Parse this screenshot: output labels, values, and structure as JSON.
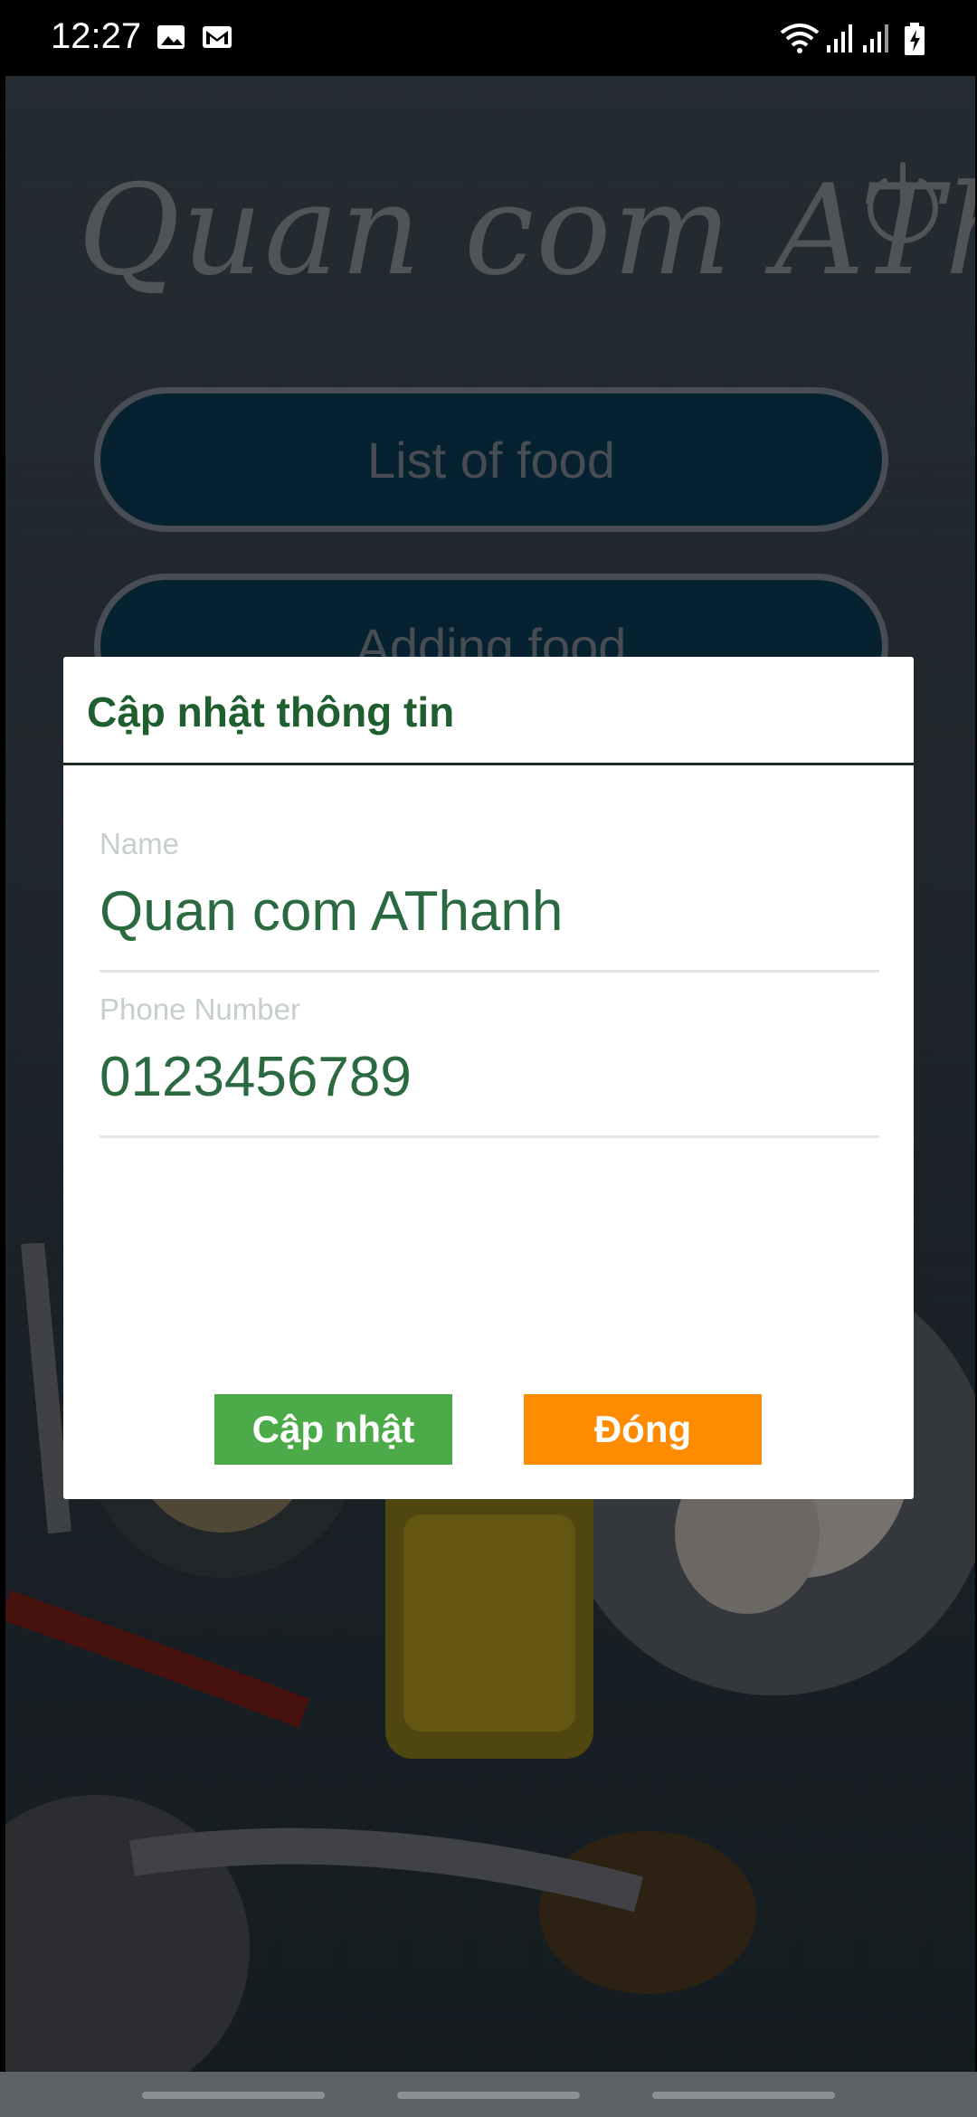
{
  "status_bar": {
    "time": "12:27",
    "icons": [
      "image-icon",
      "gmail-icon",
      "wifi-icon",
      "signal-icon",
      "signal-icon",
      "battery-charging-icon"
    ]
  },
  "app": {
    "title": "Quan com AThanh",
    "buttons": [
      {
        "label": "List of food"
      },
      {
        "label": "Adding food"
      }
    ],
    "colors": {
      "button_fill": "#0b3954",
      "button_border": "#7d8590",
      "title": "#8a9199"
    }
  },
  "dialog": {
    "title": "Cập nhật thông tin",
    "fields": [
      {
        "label": "Name",
        "value": "Quan com AThanh"
      },
      {
        "label": "Phone Number",
        "value": "0123456789"
      }
    ],
    "buttons": {
      "update": {
        "label": "Cập nhật",
        "color": "#4caa48"
      },
      "close": {
        "label": "Đóng",
        "color": "#ff8c00"
      }
    },
    "accent_color": "#1f5e2f"
  }
}
